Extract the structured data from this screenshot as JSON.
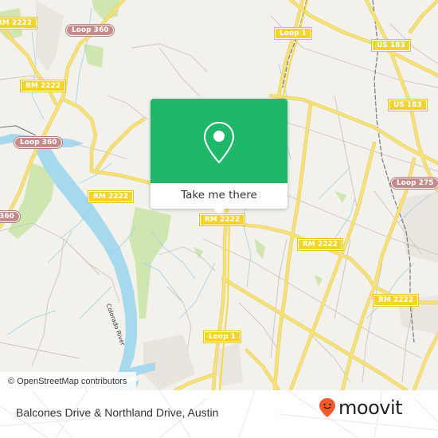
{
  "map": {
    "shields": [
      {
        "label": "RM 2222",
        "style": "yellow"
      },
      {
        "label": "Loop 360",
        "style": "pink"
      },
      {
        "label": "RM 2222",
        "style": "yellow"
      },
      {
        "label": "Loop 360",
        "style": "pink"
      },
      {
        "label": "360",
        "style": "pink"
      },
      {
        "label": "Loop 1",
        "style": "yellow"
      },
      {
        "label": "US 183",
        "style": "yellow"
      },
      {
        "label": "US 183",
        "style": "yellow"
      },
      {
        "label": "RM 2222",
        "style": "yellow"
      },
      {
        "label": "RM 2222",
        "style": "yellow"
      },
      {
        "label": "Loop 275",
        "style": "pink"
      },
      {
        "label": "RM 2222",
        "style": "yellow"
      },
      {
        "label": "RM 2222",
        "style": "yellow"
      },
      {
        "label": "Loop 1",
        "style": "yellow"
      }
    ],
    "river_label": "Colorado River",
    "attribution": "© OpenStreetMap contributors",
    "colors": {
      "land": "#f2f1ec",
      "water": "#a6d8ee",
      "park": "#cfe6b0",
      "major_road": "#f7e17a",
      "minor_road": "#c9c5bb"
    }
  },
  "popup": {
    "icon": "location-pin-icon",
    "button_label": "Take me there",
    "color": "#1fb86a"
  },
  "footer": {
    "address": "Balcones Drive & Northland Drive, Austin",
    "brand": "moovit",
    "brand_icon": "moovit-pin-logo-icon",
    "brand_color": "#f15a2b"
  }
}
